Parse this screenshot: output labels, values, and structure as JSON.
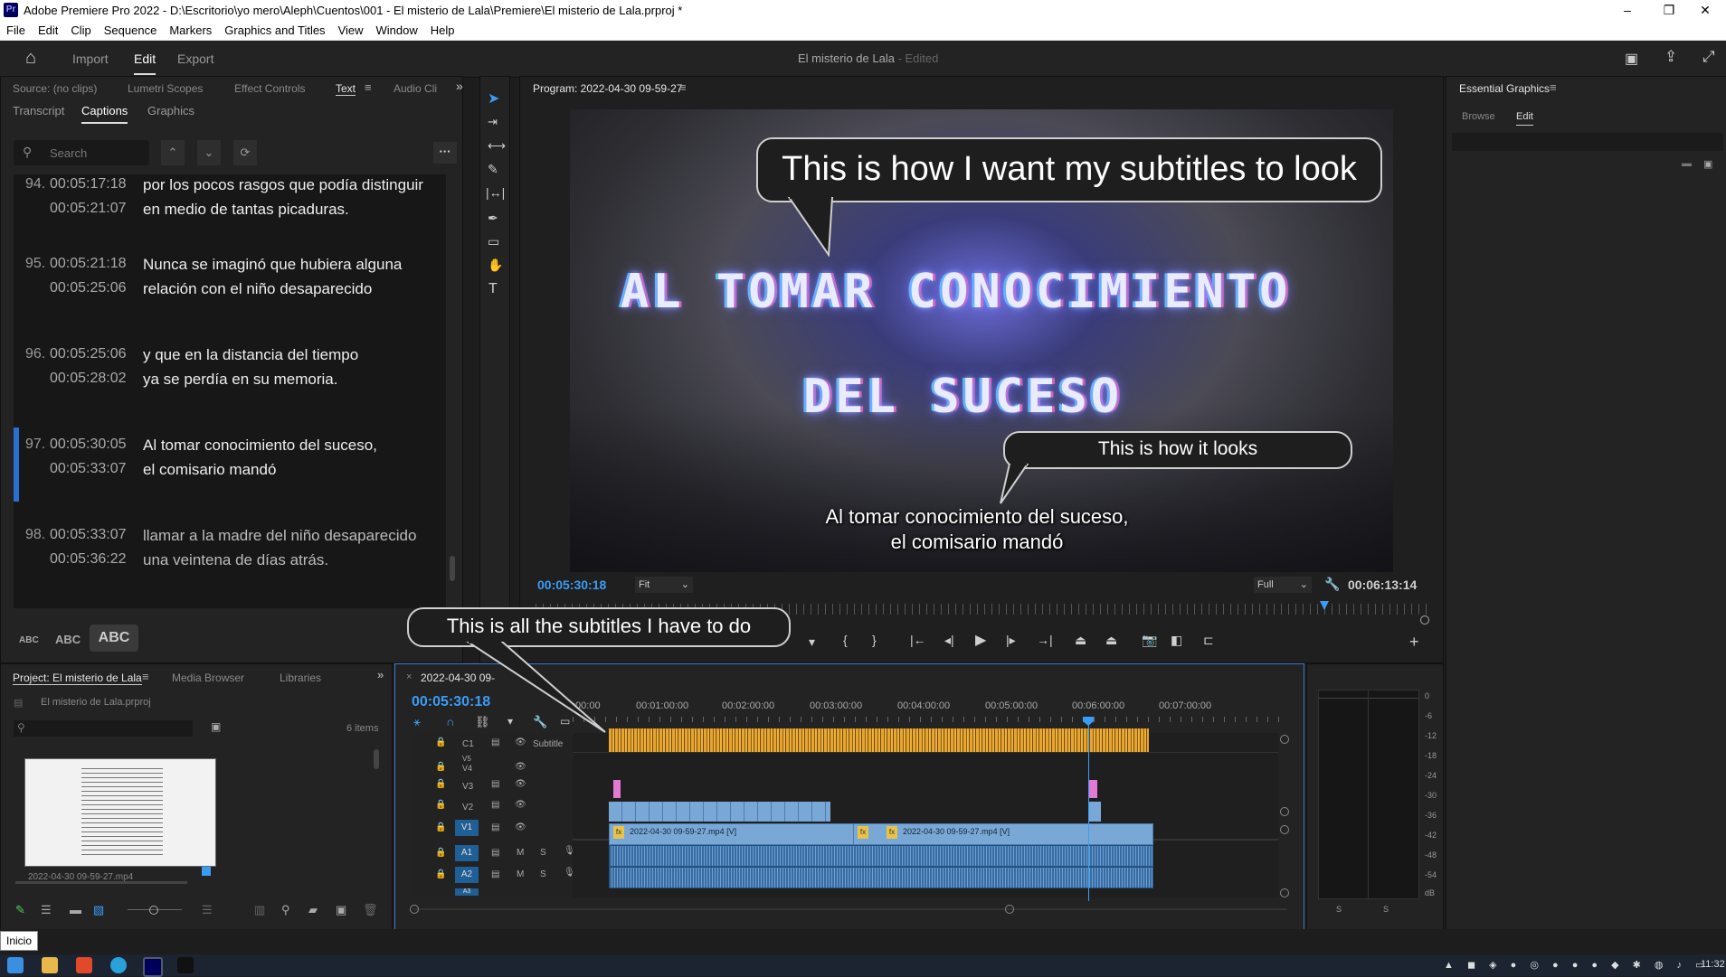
{
  "window": {
    "app_badge": "Pr",
    "title": "Adobe Premiere Pro 2022 - D:\\Escritorio\\yo mero\\Aleph\\Cuentos\\001 - El misterio de Lala\\Premiere\\El misterio de Lala.prproj *",
    "min": "–",
    "max": "❐",
    "close": "✕"
  },
  "menu": [
    "File",
    "Edit",
    "Clip",
    "Sequence",
    "Markers",
    "Graphics and Titles",
    "View",
    "Window",
    "Help"
  ],
  "workspace": {
    "tabs": [
      "Import",
      "Edit",
      "Export"
    ],
    "active": "Edit",
    "project_title": "El misterio de Lala",
    "edited": " - Edited"
  },
  "left_panel": {
    "tabs": [
      "Source: (no clips)",
      "Lumetri Scopes",
      "Effect Controls",
      "Text",
      "Audio Cli"
    ],
    "subtabs": [
      "Transcript",
      "Captions",
      "Graphics"
    ],
    "search_placeholder": "Search",
    "captions": [
      {
        "num": "94.",
        "start": "00:05:17:18",
        "end": "00:05:21:07",
        "line1": "por los pocos rasgos que podía distinguir",
        "line2": "en medio de tantas picaduras."
      },
      {
        "num": "95.",
        "start": "00:05:21:18",
        "end": "00:05:25:06",
        "line1": "Nunca se imaginó que hubiera alguna",
        "line2": "relación con el niño desaparecido"
      },
      {
        "num": "96.",
        "start": "00:05:25:06",
        "end": "00:05:28:02",
        "line1": "y que en la distancia del tiempo",
        "line2": "ya se perdía en su memoria."
      },
      {
        "num": "97.",
        "start": "00:05:30:05",
        "end": "00:05:33:07",
        "line1": "Al tomar conocimiento del suceso,",
        "line2": "el comisario mandó"
      },
      {
        "num": "98.",
        "start": "00:05:33:07",
        "end": "00:05:36:22",
        "line1": "llamar a la madre del niño desaparecido",
        "line2": "una veintena de días atrás."
      }
    ],
    "case_buttons": [
      "ABC",
      "ABC",
      "ABC"
    ]
  },
  "program": {
    "label": "Program: 2022-04-30 09-59-27",
    "title_line1": "AL TOMAR CONOCIMIENTO",
    "title_line2": "DEL SUCESO",
    "subtitle_line1": "Al tomar conocimiento del suceso,",
    "subtitle_line2": "el comisario mandó",
    "bubble_top": "This is how I want my subtitles to look",
    "bubble_mid": "This is how it looks",
    "current_tc": "00:05:30:18",
    "fit": "Fit",
    "quality": "Full",
    "duration_tc": "00:06:13:14"
  },
  "essential_graphics": {
    "title": "Essential Graphics",
    "tabs": [
      "Browse",
      "Edit"
    ],
    "active": "Edit"
  },
  "project_panel": {
    "tabs": [
      "Project: El misterio de Lala",
      "Media Browser",
      "Libraries"
    ],
    "file": "El misterio de Lala.prproj",
    "count": "6 items",
    "thumb_label": "2022-04-30 09-59-27.mp4"
  },
  "timeline": {
    "seq_tab": "2022-04-30 09-",
    "timecode": "00:05:30:18",
    "ruler": [
      ":00:00",
      "00:01:00:00",
      "00:02:00:00",
      "00:03:00:00",
      "00:04:00:00",
      "00:05:00:00",
      "00:06:00:00",
      "00:07:00:00"
    ],
    "subtitle_track": "Subtitle",
    "tracks_video": [
      "C1",
      "V5",
      "V4",
      "V3",
      "V2",
      "V1"
    ],
    "tracks_audio": [
      "A1",
      "A2",
      "A3"
    ],
    "clip1": "2022-04-30 09-59-27.mp4 [V]",
    "clip2": "2022-04-30 09-59-27.mp4 [V]",
    "bubble": "This is all the subtitles I have to do"
  },
  "meter": {
    "scale": [
      "0",
      "-6",
      "-12",
      "-18",
      "-24",
      "-30",
      "-36",
      "-42",
      "-48",
      "-54",
      "dB"
    ],
    "solo": [
      "S",
      "S"
    ]
  },
  "taskbar": {
    "tooltip": "Inicio",
    "clock": "11:32"
  }
}
